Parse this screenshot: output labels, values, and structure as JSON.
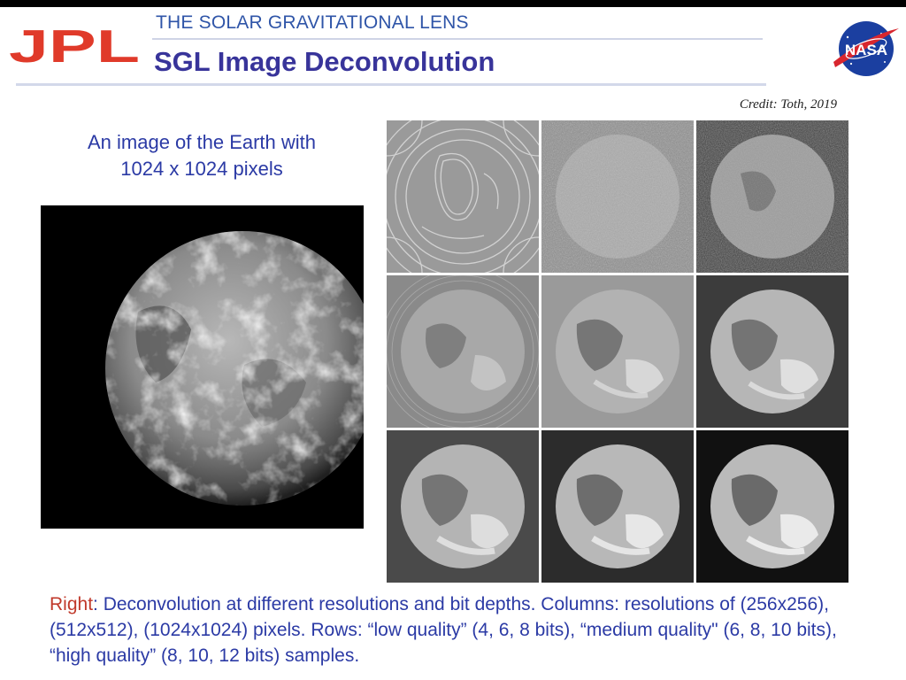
{
  "header": {
    "subtitle": "THE SOLAR GRAVITATIONAL LENS",
    "title": "SGL Image Deconvolution",
    "left_logo_text": "JPL",
    "right_logo_text": "NASA"
  },
  "credit": "Credit: Toth, 2019",
  "left_caption": {
    "line1": "An image of the Earth with",
    "line2": "1024 x 1024 pixels"
  },
  "grid": {
    "tiles": [
      {
        "quality": "low",
        "resolution": "256x256"
      },
      {
        "quality": "low",
        "resolution": "512x512"
      },
      {
        "quality": "low",
        "resolution": "1024x1024"
      },
      {
        "quality": "medium",
        "resolution": "256x256"
      },
      {
        "quality": "medium",
        "resolution": "512x512"
      },
      {
        "quality": "medium",
        "resolution": "1024x1024"
      },
      {
        "quality": "high",
        "resolution": "256x256"
      },
      {
        "quality": "high",
        "resolution": "512x512"
      },
      {
        "quality": "high",
        "resolution": "1024x1024"
      }
    ]
  },
  "bottom_caption": {
    "lead": "Right",
    "text": ": Deconvolution at different resolutions and bit depths. Columns: resolutions of (256x256), (512x512), (1024x1024) pixels. Rows: “low quality” (4, 6, 8 bits), “medium quality\" (6, 8, 10 bits), “high quality” (8, 10, 12 bits) samples."
  },
  "colors": {
    "title": "#38349a",
    "subtitle": "#2f55a8",
    "caption": "#2b3aa5",
    "highlight": "#c0392b",
    "jpl_red": "#e03a2a",
    "nasa_blue": "#1b3fa0"
  }
}
